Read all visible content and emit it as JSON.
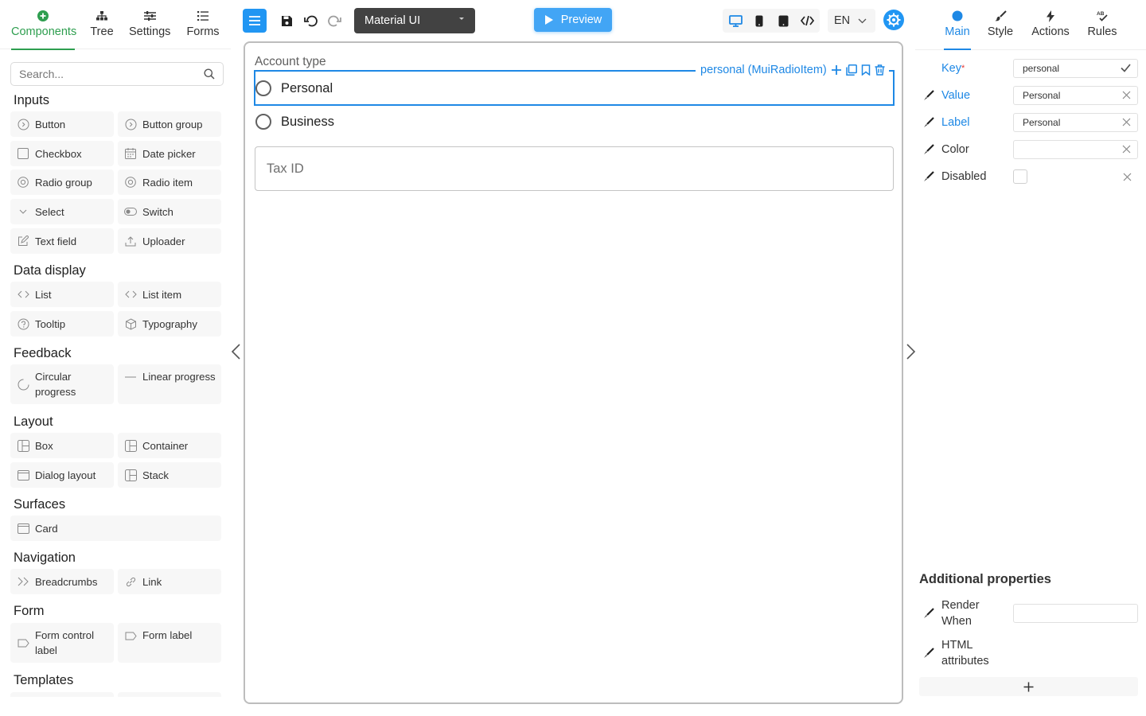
{
  "left_tabs": [
    {
      "label": "Components",
      "icon": "plus-circle-icon"
    },
    {
      "label": "Tree",
      "icon": "tree-icon"
    },
    {
      "label": "Settings",
      "icon": "sliders-icon"
    },
    {
      "label": "Forms",
      "icon": "list-icon"
    }
  ],
  "search": {
    "placeholder": "Search..."
  },
  "categories": {
    "inputs": "Inputs",
    "data_display": "Data display",
    "feedback": "Feedback",
    "layout": "Layout",
    "surfaces": "Surfaces",
    "navigation": "Navigation",
    "form": "Form",
    "templates": "Templates"
  },
  "components": {
    "button": "Button",
    "button_group": "Button group",
    "checkbox": "Checkbox",
    "date_picker": "Date picker",
    "radio_group": "Radio group",
    "radio_item": "Radio item",
    "select": "Select",
    "switch": "Switch",
    "text_field": "Text field",
    "uploader": "Uploader",
    "list": "List",
    "list_item": "List item",
    "tooltip": "Tooltip",
    "typography": "Typography",
    "circular_progress": "Circular progress",
    "linear_progress": "Linear progress",
    "box": "Box",
    "container": "Container",
    "dialog_layout": "Dialog layout",
    "stack": "Stack",
    "card": "Card",
    "breadcrumbs": "Breadcrumbs",
    "link": "Link",
    "form_control_label": "Form control label",
    "form_label": "Form label"
  },
  "toolbar": {
    "theme": "Material UI",
    "preview": "Preview",
    "language": "EN",
    "accent": "#2196f3"
  },
  "canvas": {
    "fieldset_label": "Account type",
    "radios": [
      "Personal",
      "Business"
    ],
    "selected_tag": "personal (MuiRadioItem)",
    "taxid_placeholder": "Tax ID"
  },
  "right_tabs": [
    {
      "label": "Main",
      "icon": "circle-icon"
    },
    {
      "label": "Style",
      "icon": "brush-icon"
    },
    {
      "label": "Actions",
      "icon": "lightning-icon"
    },
    {
      "label": "Rules",
      "icon": "spellcheck-icon"
    }
  ],
  "props": {
    "key_label": "Key",
    "key_required": "*",
    "key_value": "personal",
    "value_label": "Value",
    "value_value": "Personal",
    "label_label": "Label",
    "label_value": "Personal",
    "color_label": "Color",
    "color_value": "",
    "disabled_label": "Disabled"
  },
  "additional": {
    "title": "Additional properties",
    "render_when": "Render When",
    "html_attributes": "HTML attributes",
    "render_when_value": ""
  }
}
